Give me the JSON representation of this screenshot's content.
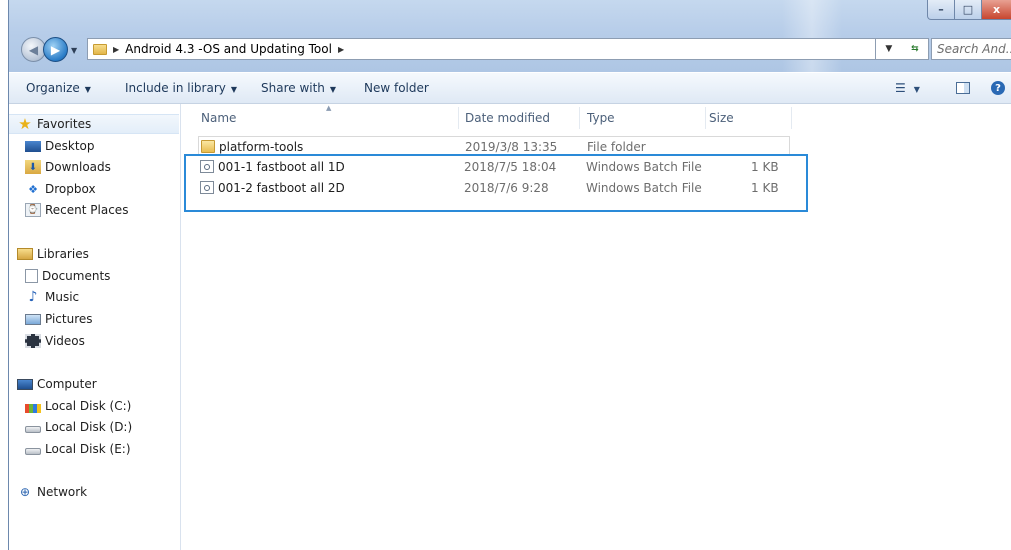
{
  "window": {
    "controls": {
      "minimize": "–",
      "maximize": "□",
      "close": "x"
    }
  },
  "address": {
    "path_label": "Android 4.3 -OS and Updating Tool",
    "search_placeholder": "Search And..."
  },
  "toolbar": {
    "organize": "Organize",
    "include_in_library": "Include in library",
    "share_with": "Share with",
    "new_folder": "New folder"
  },
  "sidebar": {
    "favorites": {
      "label": "Favorites",
      "items": [
        {
          "label": "Desktop",
          "icon": "desktop-icon"
        },
        {
          "label": "Downloads",
          "icon": "downloads-icon"
        },
        {
          "label": "Dropbox",
          "icon": "dropbox-icon"
        },
        {
          "label": "Recent Places",
          "icon": "recent-places-icon"
        }
      ]
    },
    "libraries": {
      "label": "Libraries",
      "items": [
        {
          "label": "Documents",
          "icon": "documents-icon"
        },
        {
          "label": "Music",
          "icon": "music-icon"
        },
        {
          "label": "Pictures",
          "icon": "pictures-icon"
        },
        {
          "label": "Videos",
          "icon": "videos-icon"
        }
      ]
    },
    "computer": {
      "label": "Computer",
      "items": [
        {
          "label": "Local Disk (C:)",
          "icon": "system-disk-icon"
        },
        {
          "label": "Local Disk (D:)",
          "icon": "disk-icon"
        },
        {
          "label": "Local Disk (E:)",
          "icon": "disk-icon"
        }
      ]
    },
    "network": {
      "label": "Network"
    }
  },
  "columns": {
    "name": "Name",
    "date": "Date modified",
    "type": "Type",
    "size": "Size"
  },
  "files": [
    {
      "name": "platform-tools",
      "date": "2019/3/8 13:35",
      "type": "File folder",
      "size": "",
      "icon": "folder-icon"
    },
    {
      "name": "001-1 fastboot all 1D",
      "date": "2018/7/5 18:04",
      "type": "Windows Batch File",
      "size": "1 KB",
      "icon": "batch-file-icon"
    },
    {
      "name": "001-2 fastboot all 2D",
      "date": "2018/7/6 9:28",
      "type": "Windows Batch File",
      "size": "1 KB",
      "icon": "batch-file-icon"
    }
  ],
  "colors": {
    "highlight_box": "#2a8ad8",
    "titlebar": "#b7cde9"
  }
}
